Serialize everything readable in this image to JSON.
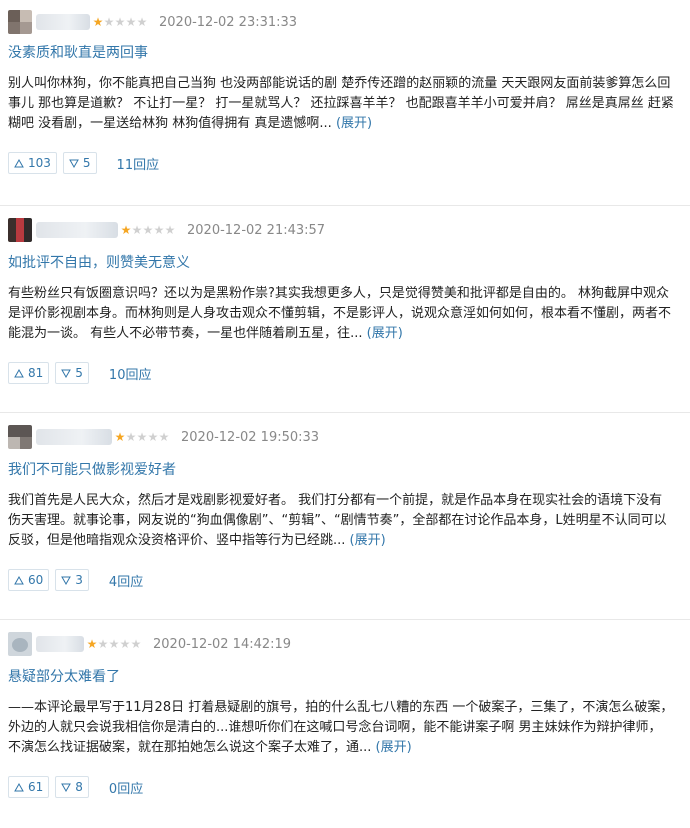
{
  "reviews": [
    {
      "rating": 1,
      "time": "2020-12-02 23:31:33",
      "title": "没素质和耿直是两回事",
      "content": "别人叫你林狗，你不能真把自己当狗 也没两部能说话的剧 楚乔传还蹭的赵丽颖的流量 天天跟网友面前装爹算怎么回事儿 那也算是道歉？ 不让打一星？ 打一星就骂人？ 还拉踩喜羊羊？ 也配跟喜羊羊小可爱并肩？ 屌丝是真屌丝 赶紧糊吧 没看剧，一星送给林狗 林狗值得拥有 真是遗憾啊...",
      "expand": "(展开)",
      "up": "103",
      "down": "5",
      "replies": "11回应"
    },
    {
      "rating": 1,
      "time": "2020-12-02 21:43:57",
      "title": "如批评不自由，则赞美无意义",
      "content": "有些粉丝只有饭圈意识吗？还以为是黑粉作祟?其实我想更多人，只是觉得赞美和批评都是自由的。 林狗截屏中观众是评价影视剧本身。而林狗则是人身攻击观众不懂剪辑，不是影评人，说观众意淫如何如何，根本看不懂剧，两者不能混为一谈。 有些人不必带节奏，一星也伴随着刷五星，往...",
      "expand": "(展开)",
      "up": "81",
      "down": "5",
      "replies": "10回应"
    },
    {
      "rating": 1,
      "time": "2020-12-02 19:50:33",
      "title": "我们不可能只做影视爱好者",
      "content": "我们首先是人民大众，然后才是戏剧影视爱好者。 我们打分都有一个前提，就是作品本身在现实社会的语境下没有伤天害理。就事论事，网友说的“狗血偶像剧”、“剪辑”、“剧情节奏”，全部都在讨论作品本身，L姓明星不认同可以反驳，但是他暗指观众没资格评价、竖中指等行为已经跳...",
      "expand": "(展开)",
      "up": "60",
      "down": "3",
      "replies": "4回应"
    },
    {
      "rating": 1,
      "time": "2020-12-02 14:42:19",
      "title": "悬疑部分太难看了",
      "content": "——本评论最早写于11月28日 打着悬疑剧的旗号，拍的什么乱七八糟的东西 一个破案子，三集了，不演怎么破案，外边的人就只会说我相信你是清白的...谁想听你们在这喊口号念台词啊，能不能讲案子啊 男主妹妹作为辩护律师，不演怎么找证据破案，就在那拍她怎么说这个案子太难了，通...",
      "expand": "(展开)",
      "up": "61",
      "down": "8",
      "replies": "0回应"
    }
  ],
  "icons": {
    "up": "triangle-up-icon",
    "down": "triangle-down-icon",
    "star": "star-icon"
  },
  "colors": {
    "link": "#3377aa",
    "star_on": "#f5a623",
    "star_off": "#d0d0d0",
    "meta": "#888888"
  }
}
